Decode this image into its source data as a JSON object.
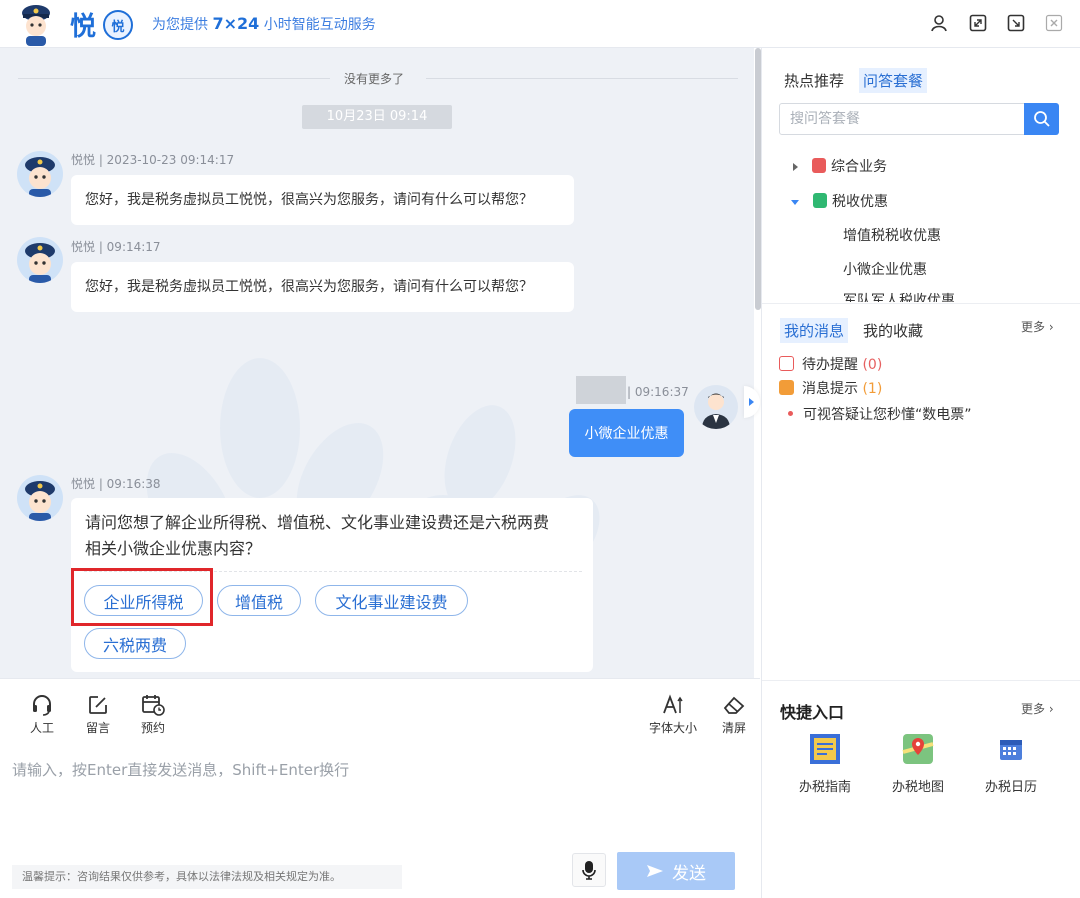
{
  "header": {
    "logo_text": "悦",
    "logo_badge": "悦",
    "tagline_prefix": "为您提供 ",
    "tagline_highlight": "7×24",
    "tagline_suffix": " 小时智能互动服务",
    "icons": [
      "user-icon",
      "expand-icon",
      "minimize-icon",
      "close-icon"
    ]
  },
  "chat": {
    "no_more": "没有更多了",
    "date_chip": "10月23日 09:14",
    "messages": [
      {
        "meta": "悦悦 | 2023-10-23 09:14:17",
        "text": "您好，我是税务虚拟员工悦悦，很高兴为您服务，请问有什么可以帮您？"
      },
      {
        "meta": "悦悦 | 09:14:17",
        "text": "您好，我是税务虚拟员工悦悦，很高兴为您服务，请问有什么可以帮您？"
      }
    ],
    "user_message": {
      "time": "| 09:16:37",
      "text": "小微企业优惠"
    },
    "bot_reply": {
      "meta": "悦悦 | 09:16:38",
      "line1": "请问您想了解企业所得税、增值税、文化事业建设费还是六税两费",
      "line2": "相关小微企业优惠内容？",
      "options": [
        "企业所得税",
        "增值税",
        "文化事业建设费",
        "六税两费"
      ]
    }
  },
  "toolbar": {
    "human_label": "人工",
    "message_label": "留言",
    "appointment_label": "预约",
    "font_size_label": "字体大小",
    "clear_label": "清屏"
  },
  "input": {
    "placeholder": "请输入，按Enter直接发送消息，Shift+Enter换行",
    "tip": "温馨提示：咨询结果仅供参考，具体以法律法规及相关规定为准。",
    "send_label": "发送"
  },
  "right_panel": {
    "tabs": [
      "热点推荐",
      "问答套餐"
    ],
    "search_placeholder": "搜问答套餐",
    "tree": [
      {
        "label": "综合业务",
        "color": "#e95b5b",
        "expanded": false
      },
      {
        "label": "税收优惠",
        "color": "#2fb872",
        "expanded": true
      }
    ],
    "tree_children": [
      "增值税税收优惠",
      "小微企业优惠",
      "军队军人税收优惠"
    ],
    "msg_tabs": [
      "我的消息",
      "我的收藏"
    ],
    "more_label": "更多",
    "messages": [
      {
        "label": "待办提醒",
        "count": "(0)"
      },
      {
        "label": "消息提示",
        "count": "(1)"
      },
      {
        "label": "可视答疑让您秒懂“数电票”"
      }
    ],
    "quick_title": "快捷入口",
    "quick_more": "更多",
    "quick_items": [
      "办税指南",
      "办税地图",
      "办税日历"
    ]
  }
}
